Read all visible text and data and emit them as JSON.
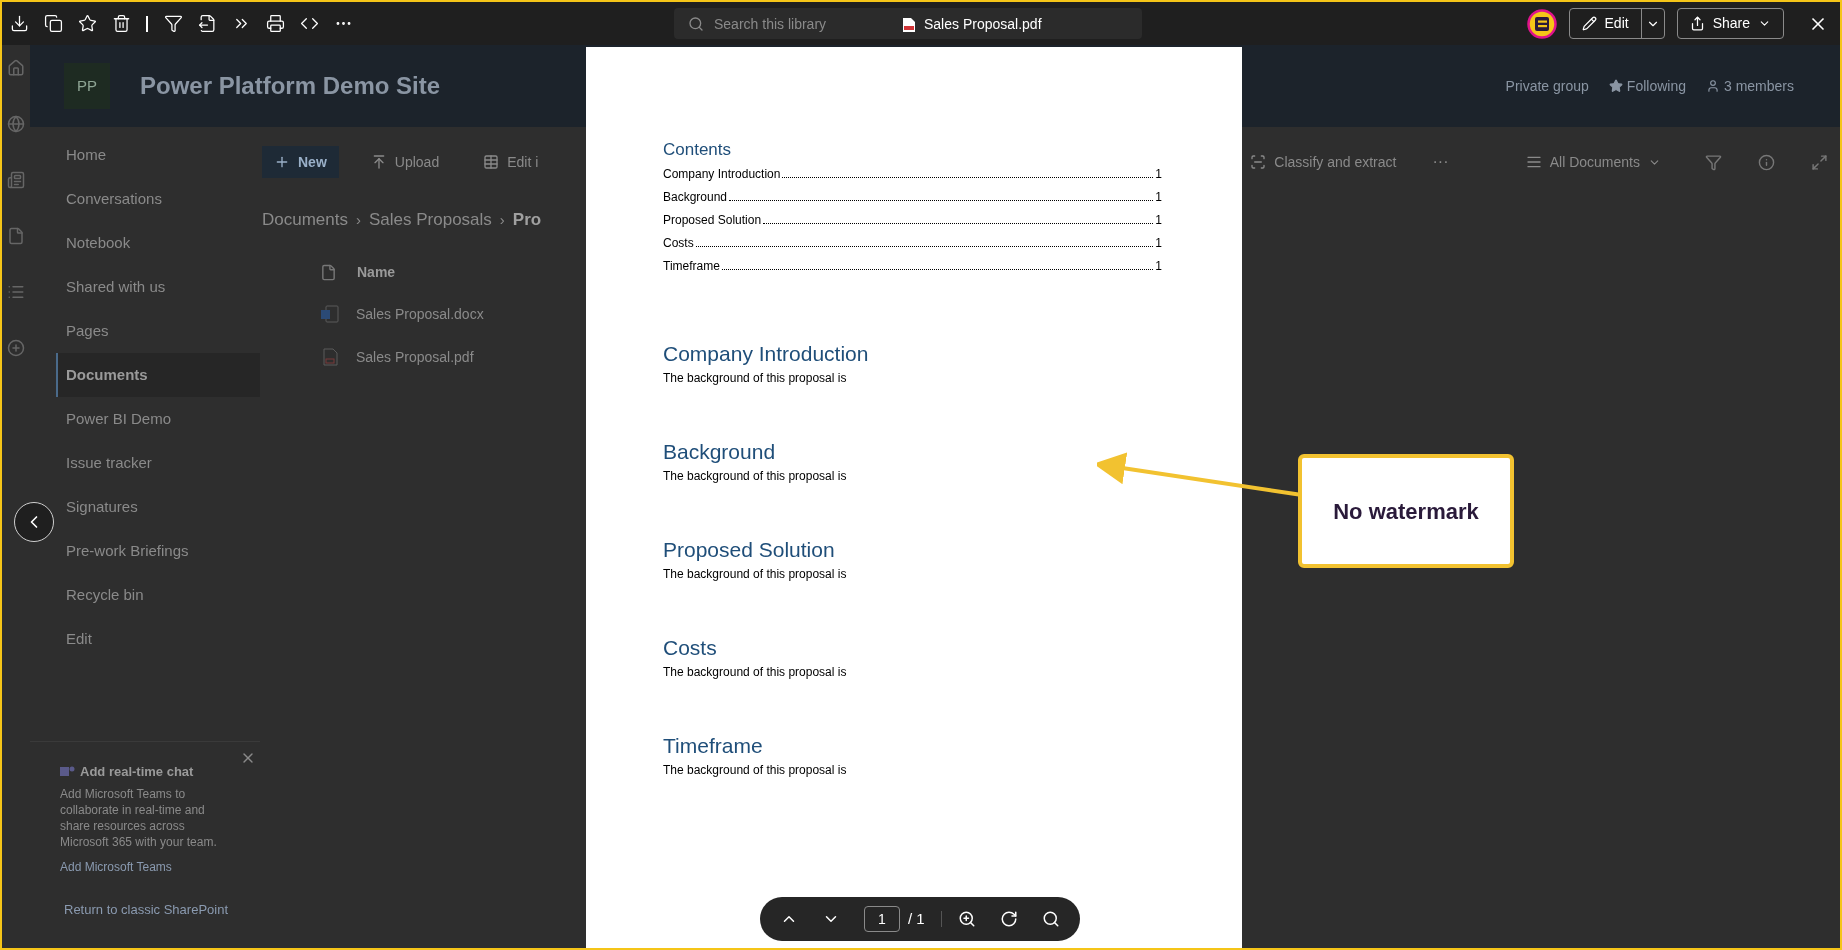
{
  "top_bar": {
    "search": {
      "placeholder": "Search this library"
    },
    "document_title": "Sales Proposal.pdf",
    "edit_button": "Edit",
    "share_button": "Share"
  },
  "site": {
    "logo": "PP",
    "title": "Power Platform Demo Site",
    "meta": [
      {
        "kind": "group",
        "label": "Private group"
      },
      {
        "kind": "follow",
        "label": "Following"
      },
      {
        "kind": "members",
        "label": "3 members"
      }
    ]
  },
  "nav": {
    "items": [
      {
        "label": "Home",
        "selected": false
      },
      {
        "label": "Conversations",
        "selected": false
      },
      {
        "label": "Notebook",
        "selected": false
      },
      {
        "label": "Shared with us",
        "selected": false
      },
      {
        "label": "Pages",
        "selected": false
      },
      {
        "label": "Documents",
        "selected": true
      },
      {
        "label": "Power BI Demo",
        "selected": false
      },
      {
        "label": "Issue tracker",
        "selected": false
      },
      {
        "label": "Signatures",
        "selected": false
      },
      {
        "label": "Pre-work Briefings",
        "selected": false
      },
      {
        "label": "Recycle bin",
        "selected": false
      },
      {
        "label": "Edit",
        "selected": false
      }
    ]
  },
  "teams_card": {
    "title": "Add real-time chat",
    "body": "Add Microsoft Teams to collaborate in real-time and share resources across Microsoft 365 with your team.",
    "link": "Add Microsoft Teams"
  },
  "return_link": "Return to classic SharePoint",
  "command_bar": {
    "left": [
      {
        "kind": "new",
        "label": "New"
      },
      {
        "kind": "upload",
        "label": "Upload"
      },
      {
        "kind": "grid",
        "label": "Edit i"
      }
    ],
    "classify": "Classify and extract",
    "more": "···",
    "view": "All Documents"
  },
  "breadcrumb": {
    "separator": "›",
    "items": [
      "Documents",
      "Sales Proposals",
      "Pro"
    ]
  },
  "files": {
    "column": "Name",
    "rows": [
      {
        "kind": "word",
        "name": "Sales Proposal.docx"
      },
      {
        "kind": "pdf",
        "name": "Sales Proposal.pdf"
      }
    ]
  },
  "pdf": {
    "contents_title": "Contents",
    "toc": [
      {
        "title": "Company Introduction",
        "page": "1"
      },
      {
        "title": "Background",
        "page": "1"
      },
      {
        "title": "Proposed Solution",
        "page": "1"
      },
      {
        "title": "Costs",
        "page": "1"
      },
      {
        "title": "Timeframe",
        "page": "1"
      }
    ],
    "sections": [
      {
        "heading": "Company Introduction",
        "body": "The background of this proposal is"
      },
      {
        "heading": "Background",
        "body": "The background of this proposal is"
      },
      {
        "heading": "Proposed Solution",
        "body": "The background of this proposal is"
      },
      {
        "heading": "Costs",
        "body": "The background of this proposal is"
      },
      {
        "heading": "Timeframe",
        "body": "The background of this proposal is"
      }
    ]
  },
  "pager": {
    "page": "1",
    "total": "/ 1"
  },
  "callout": {
    "text": "No watermark"
  }
}
